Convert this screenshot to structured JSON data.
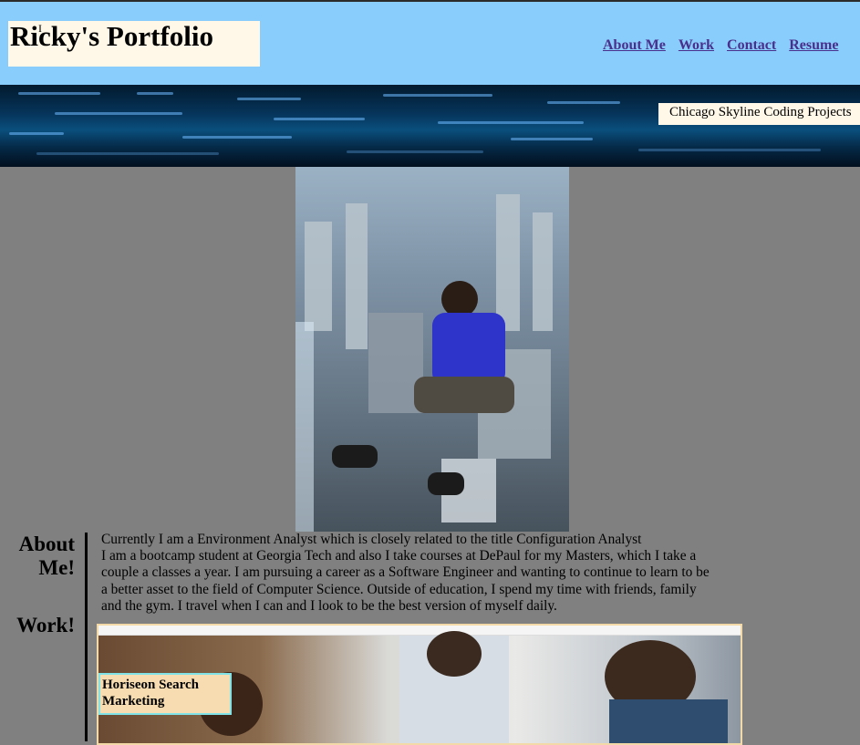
{
  "header": {
    "brand": "Ricky's Portfolio",
    "nav": [
      {
        "label": "About Me"
      },
      {
        "label": "Work"
      },
      {
        "label": "Contact"
      },
      {
        "label": "Resume"
      }
    ]
  },
  "hero": {
    "marquee_text": "Chicago Skyline Coding Projects"
  },
  "about": {
    "heading": "About Me!",
    "lines": [
      "Currently I am a Environment Analyst which is closely related to the title Configuration Analyst",
      "I am a bootcamp student at Georgia Tech and also I take courses at DePaul for my Masters, which I take a couple a classes a year. I am pursuing a career as a Software Engineer and wanting to continue to learn to be a better asset to the field of Computer Science. Outside of education, I spend my time with friends, family and the gym. I travel when I can and I look to be the best version of myself daily."
    ]
  },
  "work": {
    "heading": "Work!",
    "projects": [
      {
        "title": "Horiseon Search Marketing"
      }
    ]
  },
  "colors": {
    "header_bg": "#88cdfb",
    "page_bg": "#808080",
    "brand_box": "#fff8e8",
    "nav_link": "#4a2f8c",
    "caption_bg": "#f6dcb0",
    "caption_border": "#7fe3e8"
  }
}
